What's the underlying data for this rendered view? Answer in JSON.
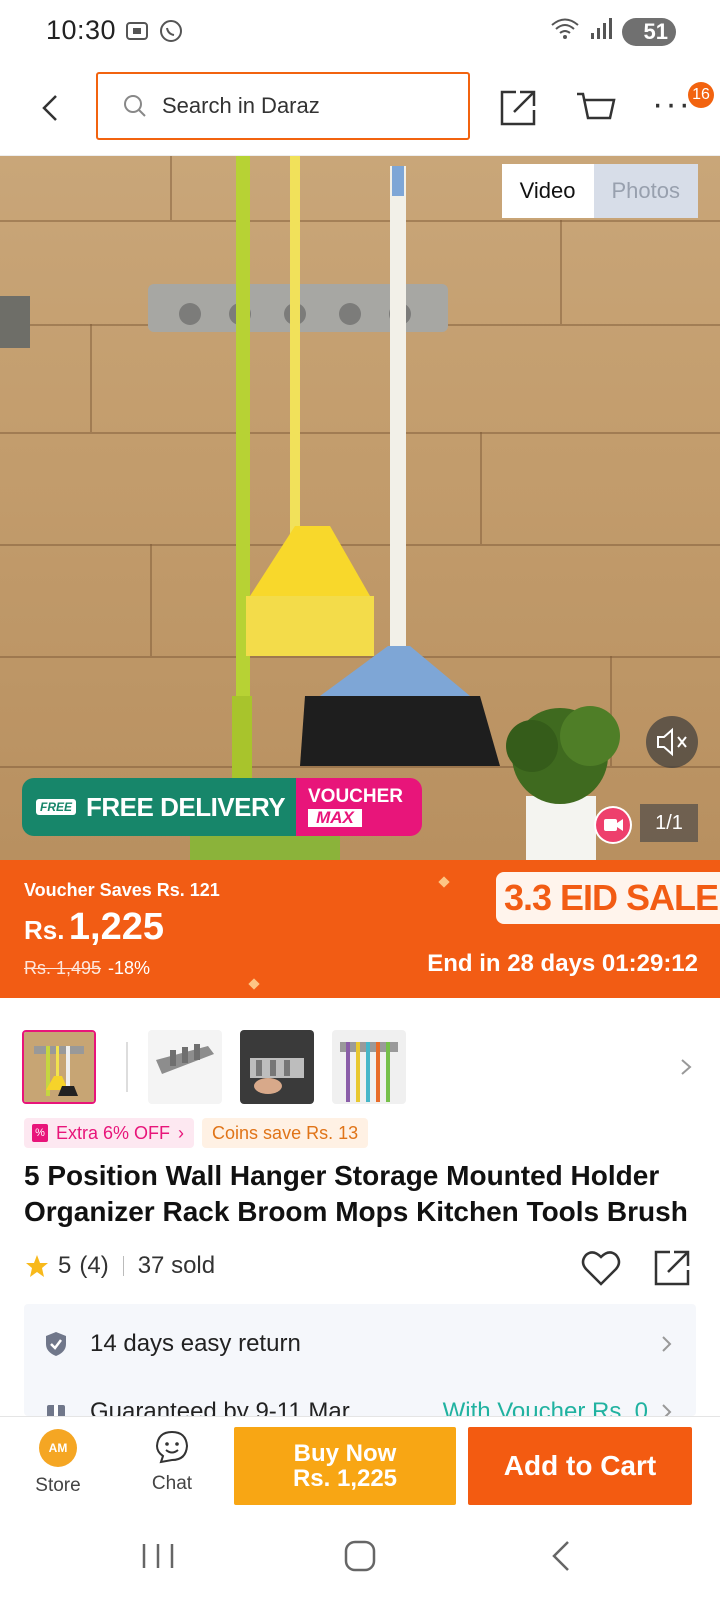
{
  "status_bar": {
    "time": "10:30",
    "battery": "51"
  },
  "header": {
    "search_placeholder": "Search in Daraz",
    "more_badge": "16"
  },
  "media": {
    "tabs": [
      {
        "label": "Video",
        "active": true
      },
      {
        "label": "Photos",
        "active": false
      }
    ],
    "page_indicator": "1/1",
    "promo": {
      "free_badge": "FREE",
      "free_label": "FREE DELIVERY",
      "voucher_top": "VOUCHER",
      "voucher_bottom": "MAX"
    }
  },
  "price_banner": {
    "voucher_saves": "Voucher Saves Rs. 121",
    "currency": "Rs.",
    "price": "1,225",
    "old_price": "Rs. 1,495",
    "discount": "-18%",
    "sale_tag": "3.3 EID SALE",
    "countdown": "End in 28 days 01:29:12"
  },
  "tags": {
    "extra_off": "Extra 6% OFF",
    "coins": "Coins save Rs. 13"
  },
  "product": {
    "title": "5 Position Wall Hanger Storage Mounted Holder Organizer Rack Broom Mops Kitchen Tools Brush",
    "rating": "5",
    "reviews": "(4)",
    "sold": "37 sold"
  },
  "info": {
    "return_text": "14 days easy return",
    "guarantee_text": "Guaranteed by 9-11 Mar",
    "guarantee_voucher": "With Voucher Rs. 0"
  },
  "actions": {
    "store_label": "Store",
    "store_logo_text": "AM",
    "chat_label": "Chat",
    "buy_now_line1": "Buy Now",
    "buy_now_line2": "Rs. 1,225",
    "add_to_cart": "Add to Cart"
  },
  "colors": {
    "brand_orange": "#f25c14",
    "buy_now": "#f8a614",
    "free_delivery_green": "#17866a",
    "voucher_pink": "#e8157a",
    "teal_text": "#20b2a0"
  }
}
